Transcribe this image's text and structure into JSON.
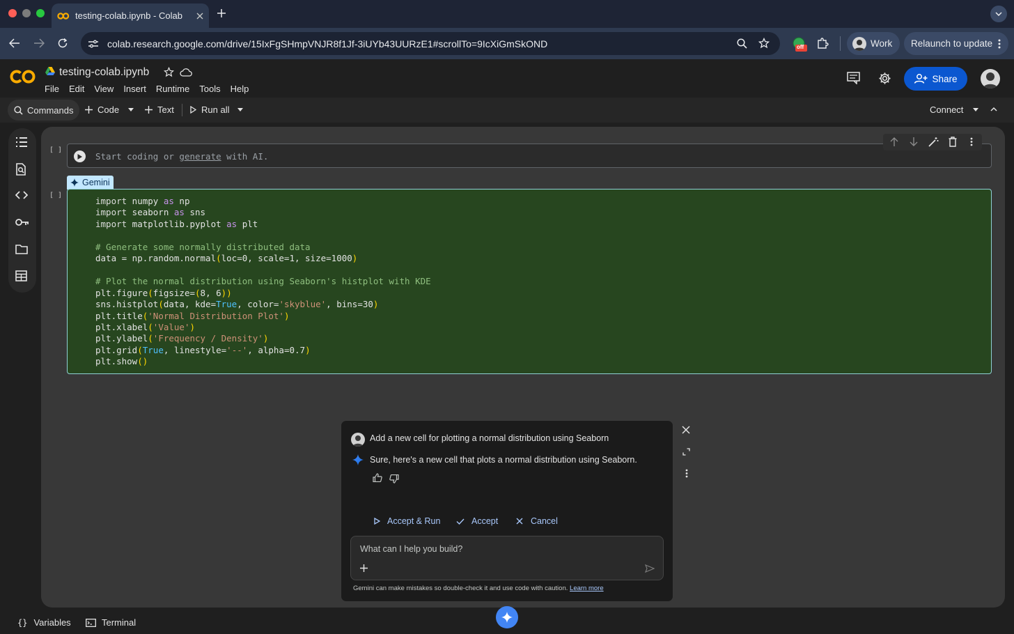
{
  "browser": {
    "tab_title": "testing-colab.ipynb - Colab",
    "url": "colab.research.google.com/drive/15IxFgSHmpVNJR8f1Jf-3iUYb43UURzE1#scrollTo=9IcXiGmSkOND",
    "profile_label": "Work",
    "relaunch_label": "Relaunch to update",
    "extension_badge": "off"
  },
  "header": {
    "logo_text": "CO",
    "notebook_title": "testing-colab.ipynb",
    "menu": [
      "File",
      "Edit",
      "View",
      "Insert",
      "Runtime",
      "Tools",
      "Help"
    ],
    "share_label": "Share"
  },
  "toolbar": {
    "commands_label": "Commands",
    "code_label": "Code",
    "text_label": "Text",
    "run_all_label": "Run all",
    "connect_label": "Connect"
  },
  "cells": {
    "bracket": "[ ]",
    "placeholder_pre": "Start coding or ",
    "placeholder_link": "generate",
    "placeholder_post": " with AI.",
    "gemini_tag": "Gemini"
  },
  "code_lines": [
    "import numpy as np",
    "import seaborn as sns",
    "import matplotlib.pyplot as plt",
    "",
    "# Generate some normally distributed data",
    "data = np.random.normal(loc=0, scale=1, size=1000)",
    "",
    "# Plot the normal distribution using Seaborn's histplot with KDE",
    "plt.figure(figsize=(8, 6))",
    "sns.histplot(data, kde=True, color='skyblue', bins=30)",
    "plt.title('Normal Distribution Plot')",
    "plt.xlabel('Value')",
    "plt.ylabel('Frequency / Density')",
    "plt.grid(True, linestyle='--', alpha=0.7)",
    "plt.show()"
  ],
  "gemini": {
    "user_message": "Add a new cell for plotting a normal distribution using Seaborn",
    "ai_message": "Sure, here's a new cell that plots a normal distribution using Seaborn.",
    "accept_run_label": "Accept & Run",
    "accept_label": "Accept",
    "cancel_label": "Cancel",
    "prompt_placeholder": "What can I help you build?",
    "disclaimer": "Gemini can make mistakes so double-check it and use code with caution.",
    "learn_more": "Learn more"
  },
  "statusbar": {
    "variables_label": "Variables",
    "terminal_label": "Terminal"
  },
  "colors": {
    "accent": "#a8c7fa",
    "share_bg": "#0b57d0",
    "cell_bg": "#27461f",
    "cell_border": "#8fd1d6",
    "gemini_blue": "#4285f4"
  }
}
